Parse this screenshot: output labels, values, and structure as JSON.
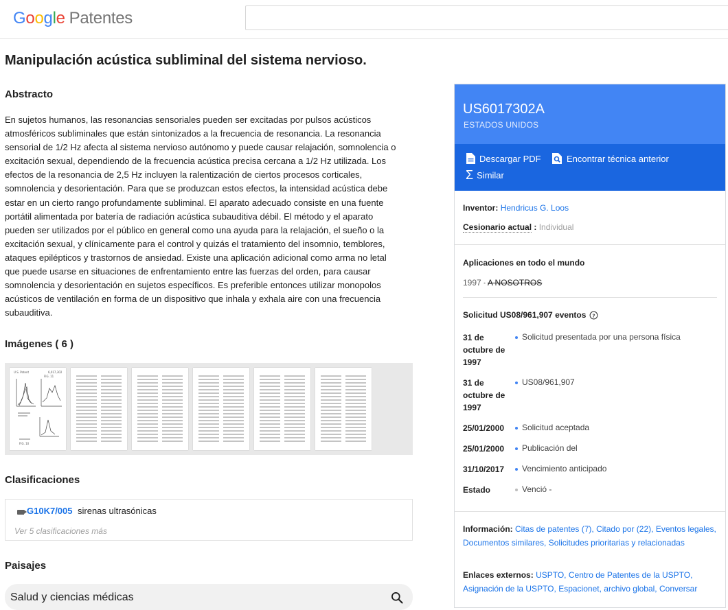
{
  "header": {
    "logo_google": "Google",
    "logo_product": "Patentes",
    "search_value": ""
  },
  "title": "Manipulación acústica subliminal del sistema nervioso.",
  "abstract": {
    "heading": "Abstracto",
    "text": "En sujetos humanos, las resonancias sensoriales pueden ser excitadas por pulsos acústicos atmosféricos subliminales que están sintonizados a la frecuencia de resonancia. La resonancia sensorial de 1/2 Hz afecta al sistema nervioso autónomo y puede causar relajación, somnolencia o excitación sexual, dependiendo de la frecuencia acústica precisa cercana a 1/2 Hz utilizada. Los efectos de la resonancia de 2,5 Hz incluyen la ralentización de ciertos procesos corticales, somnolencia y desorientación. Para que se produzcan estos efectos, la intensidad acústica debe estar en un cierto rango profundamente subliminal. El aparato adecuado consiste en una fuente portátil alimentada por batería de radiación acústica subauditiva débil. El método y el aparato pueden ser utilizados por el público en general como una ayuda para la relajación, el sueño o la excitación sexual, y clínicamente para el control y quizás el tratamiento del insomnio, temblores, ataques epilépticos y trastornos de ansiedad. Existe una aplicación adicional como arma no letal que puede usarse en situaciones de enfrentamiento entre las fuerzas del orden, para causar somnolencia y desorientación en sujetos específicos. Es preferible entonces utilizar monopolos acústicos de ventilación en forma de un dispositivo que inhala y exhala aire con una frecuencia subauditiva."
  },
  "images": {
    "heading": "Imágenes ( 6 )"
  },
  "classifications": {
    "heading": "Clasificaciones",
    "code": "G10K7/005",
    "description": "sirenas ultrasónicas",
    "more": "Ver 5 clasificaciones más"
  },
  "landscapes": {
    "heading": "Paisajes",
    "item": "Salud y ciencias médicas"
  },
  "panel": {
    "patent_number": "US6017302A",
    "country": "ESTADOS UNIDOS",
    "actions": {
      "download": "Descargar PDF",
      "prior_art": "Encontrar técnica anterior",
      "similar": "Similar"
    },
    "inventor_label": "Inventor:",
    "inventor": "Hendricus G. Loos",
    "assignee_label": "Cesionario actual",
    "assignee_sep": ":",
    "assignee": "Individual",
    "worldwide_heading": "Aplicaciones en todo el mundo",
    "worldwide_year": "1997",
    "worldwide_sep": "•",
    "worldwide_country": "A NOSOTROS",
    "events_heading": "Solicitud US08/961,907 eventos",
    "events": [
      {
        "date": "31 de octubre de 1997",
        "text": "Solicitud presentada por una persona física"
      },
      {
        "date": "31 de octubre de 1997",
        "text": "US08/961,907"
      },
      {
        "date": "25/01/2000",
        "text": "Solicitud aceptada"
      },
      {
        "date": "25/01/2000",
        "text": "Publicación del"
      },
      {
        "date": "31/10/2017",
        "text": "Vencimiento anticipado"
      },
      {
        "date": "Estado",
        "text": "Venció -"
      }
    ],
    "info_label": "Información:",
    "info_links": [
      "Citas de patentes (7),",
      "Citado por (22),",
      "Eventos legales,",
      "Documentos similares,",
      "Solicitudes prioritarias y relacionadas"
    ],
    "external_label": "Enlaces externos:",
    "external_links": [
      "USPTO,",
      "Centro de Patentes de la USPTO,",
      "Asignación de la USPTO,",
      "Espacionet,",
      "archivo global,",
      "Conversar"
    ]
  },
  "colors": {
    "panel_blue": "#4285f4",
    "panel_actions": "#1a66e0",
    "link": "#1a73e8"
  }
}
